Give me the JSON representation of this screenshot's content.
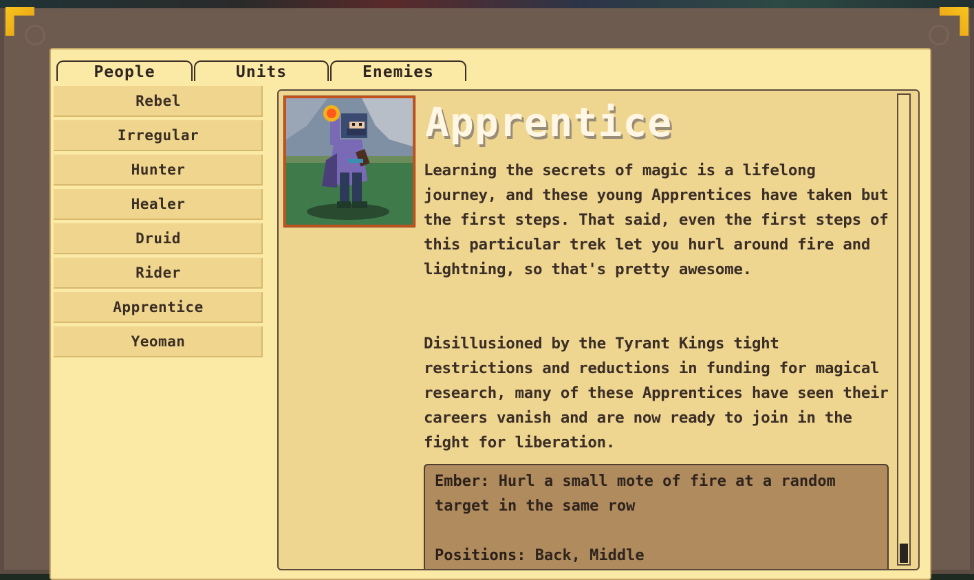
{
  "tabs": [
    {
      "label": "People"
    },
    {
      "label": "Units"
    },
    {
      "label": "Enemies"
    }
  ],
  "sidebar": {
    "items": [
      {
        "label": "Rebel"
      },
      {
        "label": "Irregular"
      },
      {
        "label": "Hunter"
      },
      {
        "label": "Healer"
      },
      {
        "label": "Druid"
      },
      {
        "label": "Rider"
      },
      {
        "label": "Apprentice"
      },
      {
        "label": "Yeoman"
      }
    ]
  },
  "detail": {
    "title": "Apprentice",
    "paragraph1": "Learning the secrets of magic is a lifelong journey, and these young Apprentices have taken but the first steps. That said, even the first steps of this particular trek let you hurl around fire and lightning, so that's pretty awesome.",
    "paragraph2": "Disillusioned by the Tyrant Kings tight restrictions and reductions in funding for magical research, many of these Apprentices have seen their careers vanish and are now ready to join in the fight for liberation.",
    "ability_name": "Ember:",
    "ability_text": "Hurl a small mote of fire at a random target in the same row",
    "positions_label": "Positions:",
    "positions_value": "Back, Middle"
  },
  "colors": {
    "frame": "#6e5b50",
    "panel": "#fbe9a6",
    "content": "#eed590",
    "accent_gold": "#f7c51e",
    "portrait_border": "#c3521f"
  },
  "icons": [
    "corner-ornament-icon",
    "scroll-thumb"
  ]
}
